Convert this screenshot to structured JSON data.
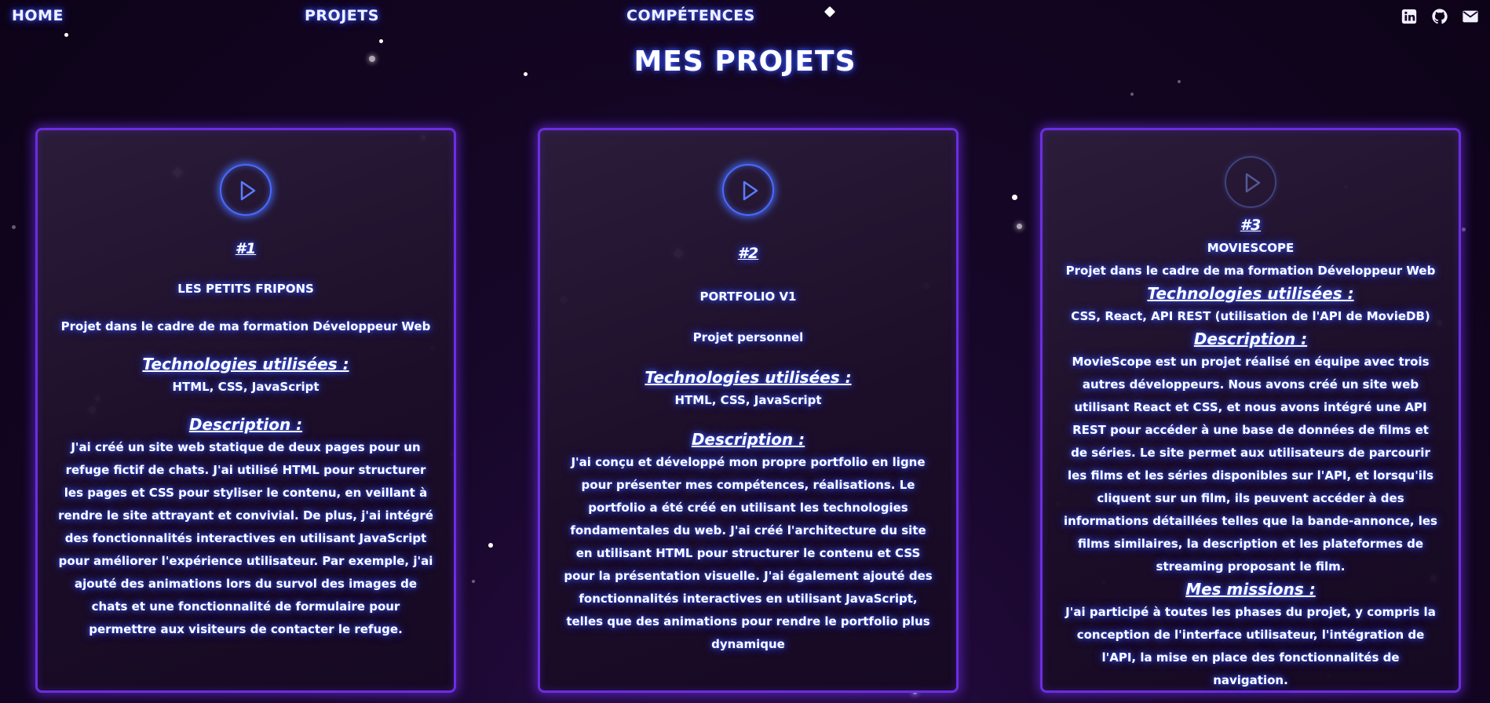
{
  "nav": {
    "home": "HOME",
    "projets": "PROJETS",
    "competences": "COMPÉTENCES",
    "social": [
      "linkedin-icon",
      "github-icon",
      "envelope-icon"
    ]
  },
  "page_title": "MES PROJETS",
  "colors": {
    "accent_border": "#6b2ee0",
    "glow_blue": "#4a6bff",
    "background": "#12051f"
  },
  "projects": [
    {
      "number": "#1",
      "name": "LES PETITS FRIPONS",
      "context": "Projet dans le cadre de ma formation Développeur Web",
      "tech_heading": "Technologies utilisées :",
      "tech": "HTML, CSS, JavaScript",
      "desc_heading": "Description :",
      "description": "J'ai créé un site web statique de deux pages pour un refuge fictif de chats. J'ai utilisé HTML pour structurer les pages et CSS pour styliser le contenu, en veillant à rendre le site attrayant et convivial. De plus, j'ai intégré des fonctionnalités interactives en utilisant JavaScript pour améliorer l'expérience utilisateur. Par exemple, j'ai ajouté des animations lors du survol des images de chats et une fonctionnalité de formulaire pour permettre aux visiteurs de contacter le refuge."
    },
    {
      "number": "#2",
      "name": "PORTFOLIO V1",
      "context": "Projet personnel",
      "tech_heading": "Technologies utilisées :",
      "tech": "HTML, CSS, JavaScript",
      "desc_heading": "Description :",
      "description": "J'ai conçu et développé mon propre portfolio en ligne pour présenter mes compétences, réalisations. Le portfolio a été créé en utilisant les technologies fondamentales du web. J'ai créé l'architecture du site en utilisant HTML pour structurer le contenu et CSS pour la présentation visuelle. J'ai également ajouté des fonctionnalités interactives en utilisant JavaScript, telles que des animations pour rendre le portfolio plus dynamique"
    },
    {
      "number": "#3",
      "name": "MOVIESCOPE",
      "context": "Projet dans le cadre de ma formation Développeur Web",
      "tech_heading": "Technologies utilisées :",
      "tech": "CSS, React, API REST (utilisation de l'API de MovieDB)",
      "desc_heading": "Description :",
      "description": "MovieScope est un projet réalisé en équipe avec trois autres développeurs. Nous avons créé un site web utilisant React et CSS, et nous avons intégré une API REST pour accéder à une base de données de films et de séries. Le site permet aux utilisateurs de parcourir les films et les séries disponibles sur l'API, et lorsqu'ils cliquent sur un film, ils peuvent accéder à des informations détaillées telles que la bande-annonce, les films similaires, la description et les plateformes de streaming proposant le film.",
      "missions_heading": "Mes missions :",
      "missions": "J'ai participé à toutes les phases du projet, y compris la conception de l'interface utilisateur, l'intégration de l'API, la mise en place des fonctionnalités de navigation."
    }
  ]
}
